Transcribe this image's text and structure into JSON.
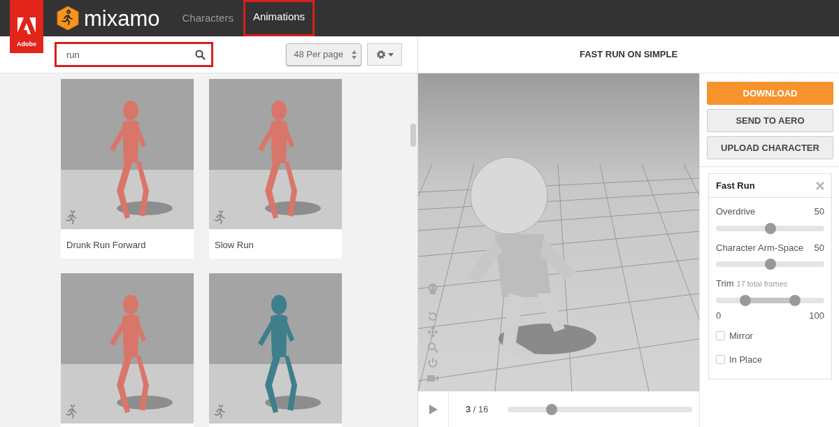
{
  "header": {
    "brand": "Adobe",
    "logo_text": "mixamo",
    "tabs": [
      {
        "label": "Characters",
        "selected": false,
        "highlighted": false
      },
      {
        "label": "Animations",
        "selected": true,
        "highlighted": true
      }
    ]
  },
  "toolbar": {
    "search": {
      "value": "run",
      "highlighted": true
    },
    "per_page": "48 Per page"
  },
  "animations": [
    {
      "name": "Drunk Run Forward",
      "color": "#d9766a"
    },
    {
      "name": "Slow Run",
      "color": "#d9766a"
    },
    {
      "color": "#d9766a"
    },
    {
      "color": "#3f7f8c"
    }
  ],
  "preview": {
    "title": "FAST RUN ON SIMPLE",
    "frame": "**3** / 16",
    "timeline": {
      "level": 0.24
    }
  },
  "actions": [
    {
      "label": "DOWNLOAD",
      "kind": "primary"
    },
    {
      "label": "SEND TO AERO",
      "kind": "secondary"
    },
    {
      "label": "UPLOAD CHARACTER",
      "kind": "secondary"
    }
  ],
  "settings": {
    "title": "Fast Run",
    "controls": [
      {
        "kind": "slider",
        "label": "Overdrive",
        "reading": "50",
        "level": 0.5
      },
      {
        "kind": "slider",
        "label": "Character Arm-Space",
        "reading": "50",
        "level": 0.5
      },
      {
        "kind": "range",
        "label": "Trim",
        "note": "17 total frames",
        "thumbs": [
          {
            "level": 0.27
          },
          {
            "level": 0.73
          }
        ],
        "min": "0",
        "max": "100"
      },
      {
        "kind": "checkbox",
        "label": "Mirror",
        "checked": false
      },
      {
        "kind": "checkbox",
        "label": "In Place",
        "checked": false
      }
    ]
  }
}
